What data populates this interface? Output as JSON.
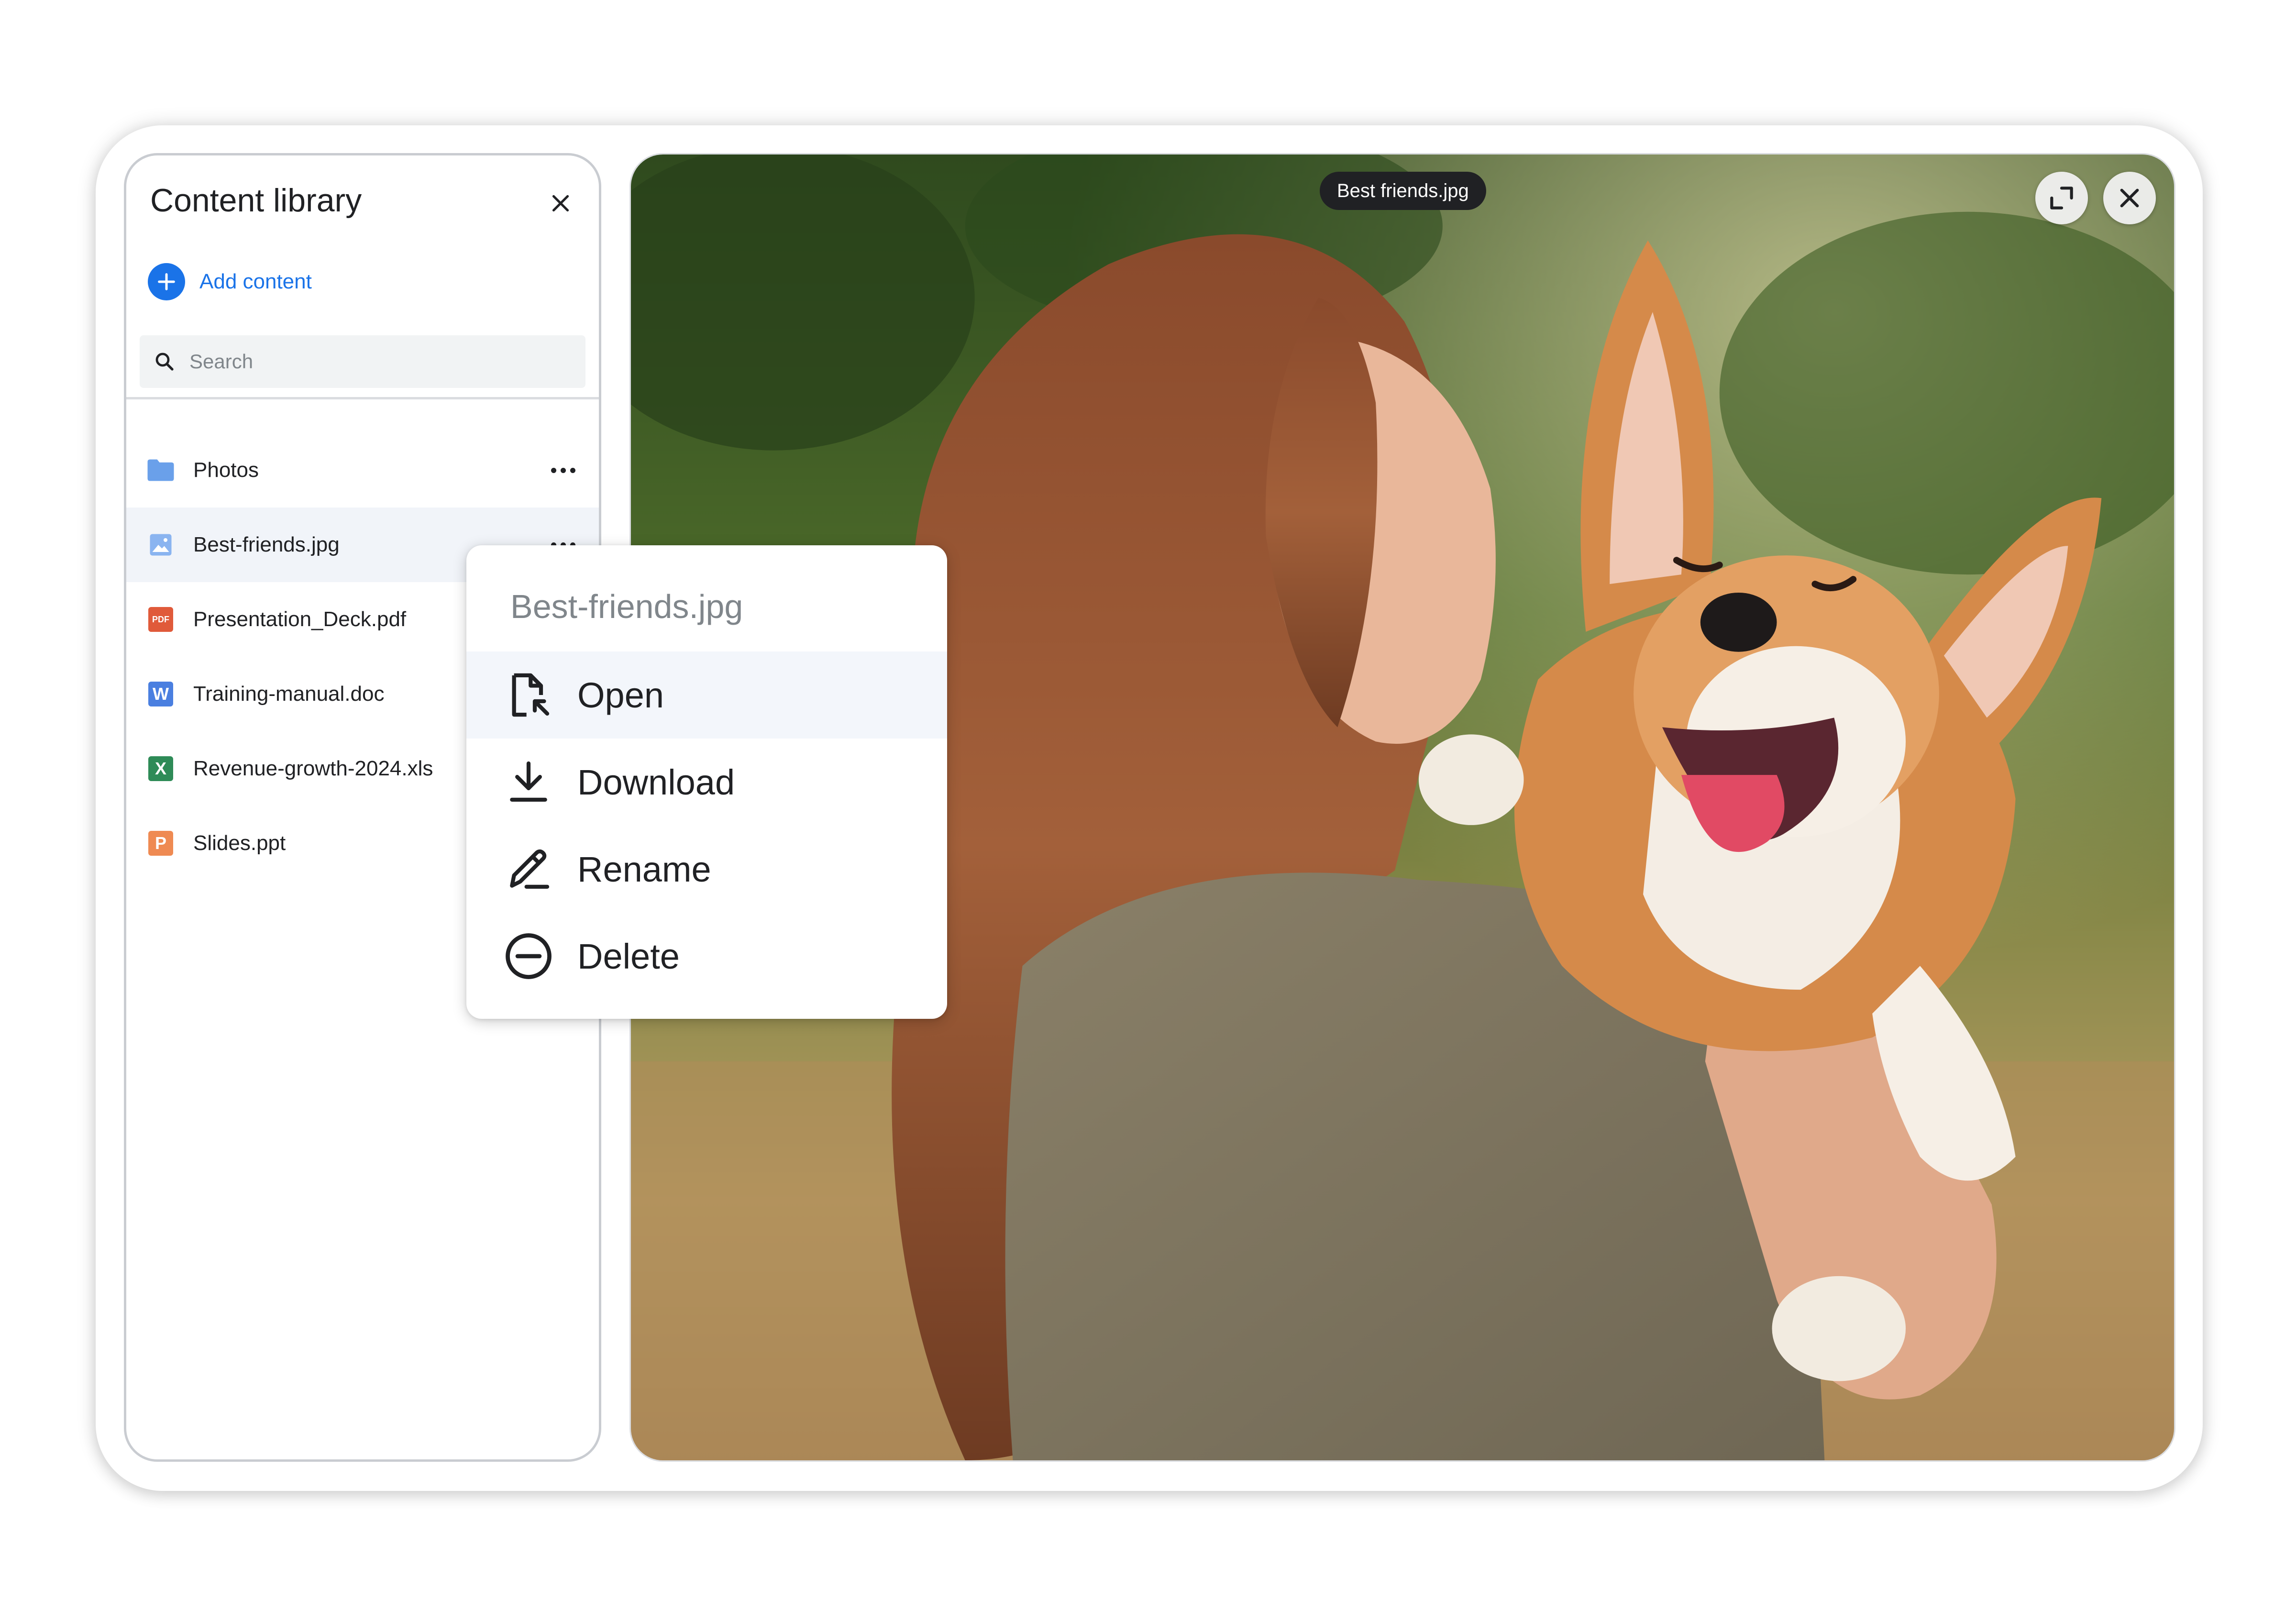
{
  "sidebar": {
    "title": "Content library",
    "add_label": "Add content",
    "search_placeholder": "Search",
    "items": [
      {
        "name": "Photos",
        "type": "folder"
      },
      {
        "name": "Best-friends.jpg",
        "type": "image"
      },
      {
        "name": "Presentation_Deck.pdf",
        "type": "pdf",
        "badge": "PDF"
      },
      {
        "name": "Training-manual.doc",
        "type": "doc",
        "badge": "W"
      },
      {
        "name": "Revenue-growth-2024.xls",
        "type": "xls",
        "badge": "X"
      },
      {
        "name": "Slides.ppt",
        "type": "ppt",
        "badge": "P"
      }
    ]
  },
  "viewer": {
    "file_label": "Best friends.jpg"
  },
  "menu": {
    "title": "Best-friends.jpg",
    "items": [
      {
        "label": "Open",
        "icon": "open-file-icon"
      },
      {
        "label": "Download",
        "icon": "download-icon"
      },
      {
        "label": "Rename",
        "icon": "rename-pen-icon"
      },
      {
        "label": "Delete",
        "icon": "delete-circle-icon"
      }
    ]
  },
  "colors": {
    "accent": "#1a73e8",
    "folder": "#6aa0ea",
    "pdf": "#e05a3a",
    "doc": "#4a7fe0",
    "xls": "#2e8b57",
    "ppt": "#ef8a52",
    "image": "#8ab4f0"
  }
}
